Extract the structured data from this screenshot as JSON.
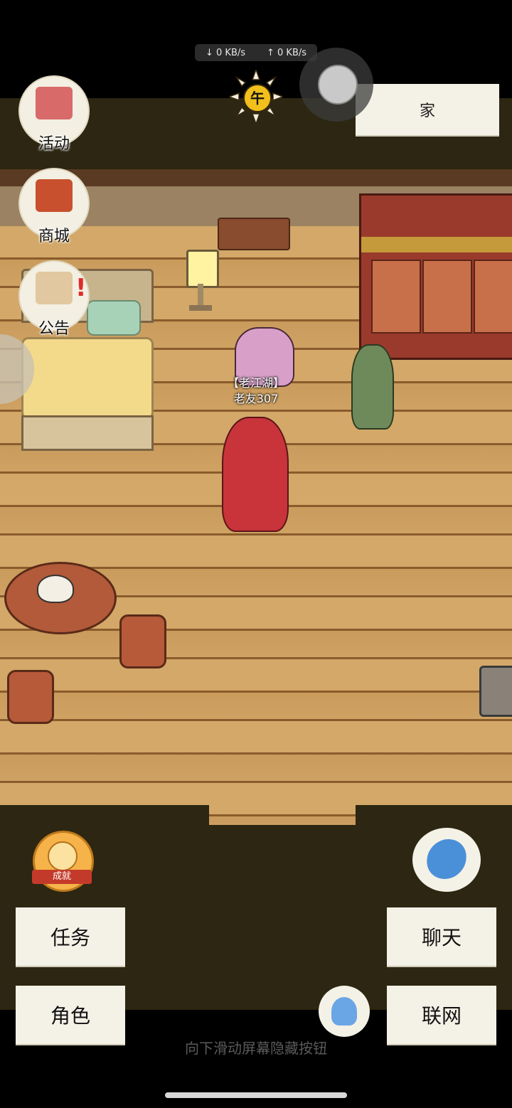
{
  "status_bar": {
    "download": "↓ 0 KB/s",
    "upload": "↑ 0 KB/s"
  },
  "time_of_day": "午",
  "location": "家",
  "side_menu": [
    {
      "label": "活动",
      "icon": "banner-icon"
    },
    {
      "label": "商城",
      "icon": "shop-icon"
    },
    {
      "label": "公告",
      "icon": "notice-board-icon"
    }
  ],
  "player": {
    "title": "【老江湖】",
    "name": "老友307"
  },
  "achievement_label": "成就",
  "buttons": {
    "tasks": "任务",
    "chat": "聊天",
    "character": "角色",
    "online": "联网"
  },
  "hint": "向下滑动屏幕隐藏按钮",
  "colors": {
    "frame": "#2c2612",
    "button_bg": "#f4f1e7",
    "floor": "#d3a868",
    "accent": "#f2c01c"
  }
}
